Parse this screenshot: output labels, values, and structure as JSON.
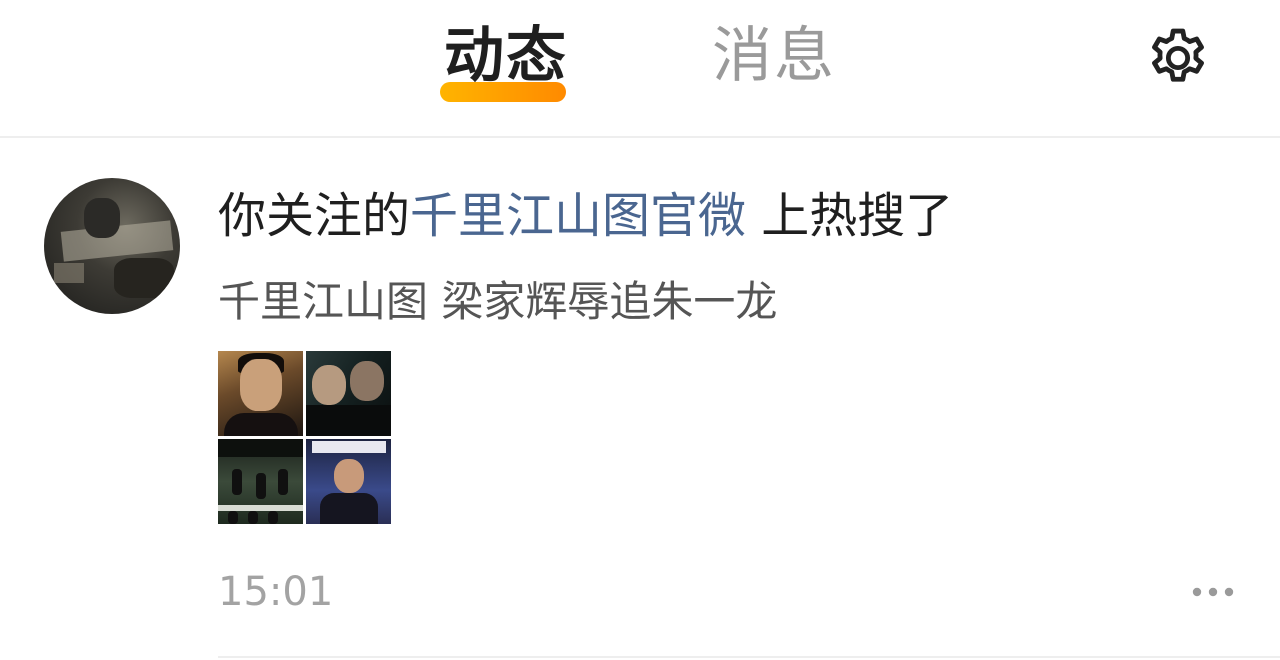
{
  "header": {
    "tabs": [
      {
        "label": "动态",
        "active": true
      },
      {
        "label": "消息",
        "active": false
      }
    ],
    "settings_icon": "gear-icon",
    "accent_color": "#ffa200"
  },
  "feed": {
    "items": [
      {
        "avatar": "avatar",
        "title_prefix": "你关注的",
        "title_link": "千里江山图官微",
        "title_suffix": " 上热搜了",
        "subtitle": "千里江山图 梁家辉辱追朱一龙",
        "thumbnail_count": 4,
        "time": "15:01",
        "more_icon": "more-dots-icon",
        "link_color": "#4a6690"
      }
    ]
  }
}
